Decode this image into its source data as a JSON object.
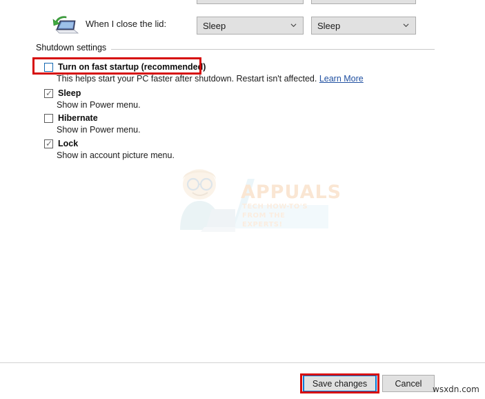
{
  "clipped_row": {
    "combo_left": {
      "value": "",
      "icon": "chevron-down-icon"
    },
    "combo_right": {
      "value": "",
      "icon": "chevron-down-icon"
    }
  },
  "lid_row": {
    "icon": "laptop-lid-close-icon",
    "label": "When I close the lid:",
    "on_battery": {
      "value": "Sleep",
      "icon": "chevron-down-icon"
    },
    "plugged_in": {
      "value": "Sleep",
      "icon": "chevron-down-icon"
    }
  },
  "shutdown_settings": {
    "group_title": "Shutdown settings",
    "options": [
      {
        "id": "fast-startup",
        "label": "Turn on fast startup (recommended)",
        "checked": false,
        "focused": true,
        "description": "This helps start your PC faster after shutdown. Restart isn't affected.",
        "link_label": "Learn More"
      },
      {
        "id": "sleep",
        "label": "Sleep",
        "checked": true,
        "focused": false,
        "description": "Show in Power menu."
      },
      {
        "id": "hibernate",
        "label": "Hibernate",
        "checked": false,
        "focused": false,
        "description": "Show in Power menu."
      },
      {
        "id": "lock",
        "label": "Lock",
        "checked": true,
        "focused": false,
        "description": "Show in account picture menu."
      }
    ]
  },
  "annotations": [
    {
      "target": "fast-startup-row",
      "color": "#d60a0a"
    },
    {
      "target": "save-changes-button",
      "color": "#d60a0a"
    }
  ],
  "watermark": {
    "brand": "APPUALS",
    "tagline": "TECH HOW-TO'S FROM THE EXPERTS!",
    "brand_color": "#f0b070",
    "tagline_color": "#f3c79a"
  },
  "footer": {
    "save_label": "Save changes",
    "cancel_label": "Cancel",
    "focus_color": "#0078d7",
    "site_credit": "wsxdn.com"
  },
  "checkmark_glyph": "✓"
}
